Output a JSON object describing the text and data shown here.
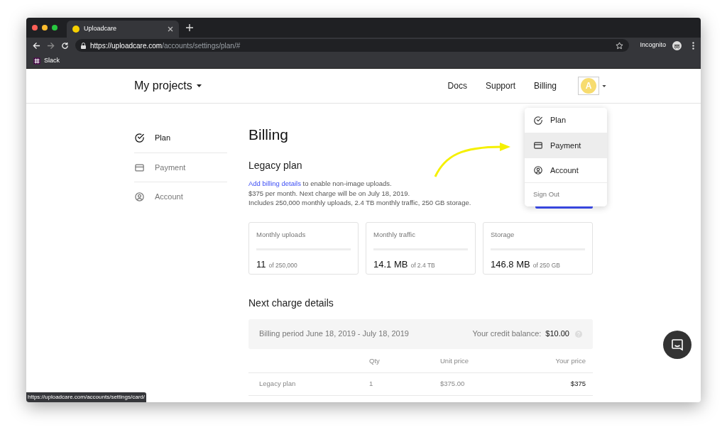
{
  "browser": {
    "tab": {
      "title": "Uploadcare"
    },
    "url": {
      "host": "https://uploadcare.com",
      "path": "/accounts/settings/plan/#"
    },
    "profile": "Incognito",
    "bookmarks": [
      {
        "label": "Slack"
      }
    ]
  },
  "header": {
    "project": "My projects",
    "nav": [
      {
        "label": "Docs"
      },
      {
        "label": "Support"
      },
      {
        "label": "Billing"
      }
    ],
    "avatar": "A"
  },
  "sidebar": [
    {
      "label": "Plan",
      "selected": true
    },
    {
      "label": "Payment",
      "selected": false
    },
    {
      "label": "Account",
      "selected": false
    }
  ],
  "title": "Billing",
  "plan": {
    "heading": "Legacy plan",
    "link": "Add billing details",
    "link_rest": " to enable non-image uploads.",
    "lines": [
      "$375 per month. Next charge will be on July 18, 2019.",
      "Includes 250,000 monthly uploads, 2.4 TB monthly traffic, 250 GB storage."
    ]
  },
  "usage": [
    {
      "label": "Monthly uploads",
      "value": "11",
      "limit": "of 250,000"
    },
    {
      "label": "Monthly traffic",
      "value": "14.1 MB",
      "limit": "of 2.4 TB"
    },
    {
      "label": "Storage",
      "value": "146.8 MB",
      "limit": "of 250 GB"
    }
  ],
  "next_charge": {
    "heading": "Next charge details",
    "period": "Billing period June 18, 2019 - July 18, 2019",
    "credit_label": "Your credit balance:",
    "credit": "$10.00"
  },
  "table": {
    "columns": [
      "Qty",
      "Unit price",
      "Your price"
    ],
    "rows": [
      {
        "item": "Legacy plan",
        "qty": "1",
        "unit_price": "$375.00",
        "price": "$375"
      }
    ]
  },
  "menu": [
    {
      "label": "Plan",
      "kind": "page",
      "selected": false
    },
    {
      "label": "Payment",
      "kind": "page",
      "selected": true
    },
    {
      "label": "Account",
      "kind": "page",
      "selected": false
    },
    {
      "label": "Sign Out",
      "kind": "action",
      "selected": false
    }
  ],
  "status_url": "https://uploadcare.com/accounts/settings/card/"
}
